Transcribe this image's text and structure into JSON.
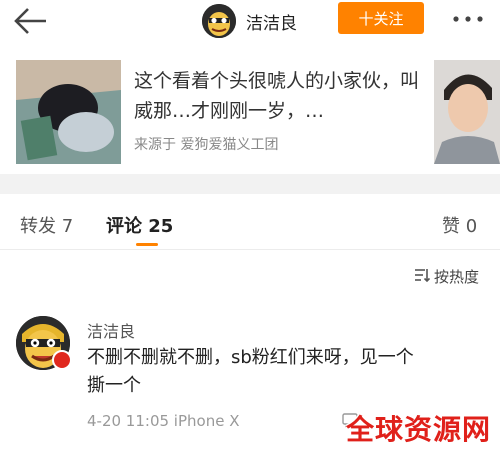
{
  "header": {
    "back_icon": "back-arrow-icon",
    "user_name": "洁洁良",
    "follow_label": "十关注",
    "more_icon": "more-dots-icon"
  },
  "repost_card": {
    "text": "这个看着个头很唬人的小家伙，叫威那…才刚刚一岁，…",
    "source": "来源于 爱狗爱猫义工团"
  },
  "tabs": {
    "repost": "转发 7",
    "comments": "评论 25",
    "likes": "赞 0"
  },
  "sort": {
    "icon": "sort-icon",
    "label": "按热度"
  },
  "comment": {
    "author": "洁洁良",
    "text": "不删不删就不删，sb粉红们来呀，见一个撕一个",
    "meta": "4-20 11:05  iPhone X"
  },
  "watermark": {
    "text": "全球资源网"
  },
  "colors": {
    "accent": "#ff8200",
    "badge_red": "#e0281e",
    "watermark_red": "#e0201a"
  }
}
